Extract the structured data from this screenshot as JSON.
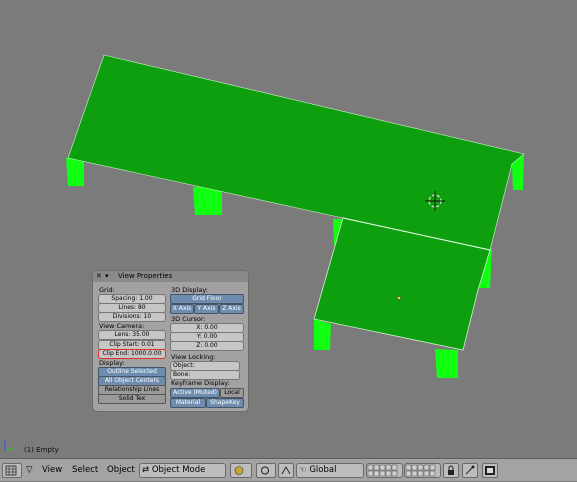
{
  "viewport": {
    "status": "(1) Empty",
    "colors": {
      "background": "#7b7b7b",
      "floor": "#0d9f0d",
      "legs": "#11ff11",
      "edge": "#d8f4d8"
    }
  },
  "panel": {
    "title": "View Properties",
    "grid_label": "Grid:",
    "spacing": "Spacing: 1.00",
    "lines": "Lines: 80",
    "divisions": "Divisions: 10",
    "view_camera_label": "View Camera:",
    "lens": "Lens: 35.00",
    "clip_start": "Clip Start: 0.01",
    "clip_end": "Clip End: 1000.0.00",
    "display_label": "Display:",
    "outline_selected": "Outline Selected",
    "all_object_centers": "All Object Centers",
    "relationship_lines": "Relationship Lines",
    "solid_tex": "Solid Tex",
    "display_3d_label": "3D Display:",
    "grid_floor": "Grid Floor",
    "x_axis": "X Axis",
    "y_axis": "Y Axis",
    "z_axis": "Z Axis",
    "cursor_label": "3D Cursor:",
    "cursor_x": "X: 0.00",
    "cursor_y": "Y: 0.00",
    "cursor_z": "Z: 0.00",
    "view_locking_label": "View Locking:",
    "object_field": "Object:",
    "bone_field": "Bone:",
    "keyframe_display_label": "Keyframe Display:",
    "active_muted": "Active (Muted)",
    "local": "Local",
    "material": "Material",
    "shapekey": "ShapeKey"
  },
  "header": {
    "view": "View",
    "select": "Select",
    "object": "Object",
    "mode": "Object Mode",
    "orientation": "Global"
  }
}
